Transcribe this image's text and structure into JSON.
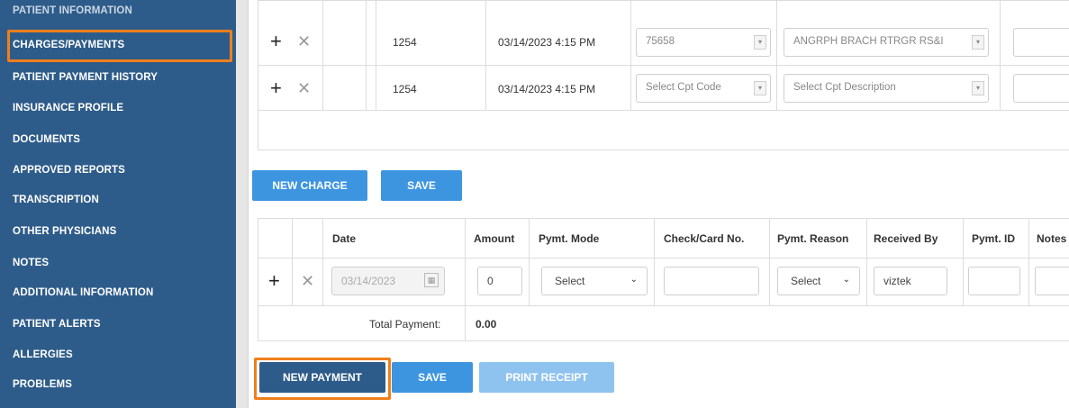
{
  "sidebar": {
    "items": [
      {
        "label": "PATIENT INFORMATION"
      },
      {
        "label": "CHARGES/PAYMENTS"
      },
      {
        "label": "PATIENT PAYMENT HISTORY"
      },
      {
        "label": "INSURANCE PROFILE"
      },
      {
        "label": "DOCUMENTS"
      },
      {
        "label": "APPROVED REPORTS"
      },
      {
        "label": "TRANSCRIPTION"
      },
      {
        "label": "OTHER PHYSICIANS"
      },
      {
        "label": "NOTES"
      },
      {
        "label": "ADDITIONAL INFORMATION"
      },
      {
        "label": "PATIENT ALERTS"
      },
      {
        "label": "ALLERGIES"
      },
      {
        "label": "PROBLEMS"
      }
    ],
    "active_index": 1
  },
  "charges": {
    "rows": [
      {
        "id": "1254",
        "datetime": "03/14/2023 4:15 PM",
        "cpt_code": "75658",
        "cpt_description": "ANGRPH BRACH RTRGR RS&I"
      },
      {
        "id": "1254",
        "datetime": "03/14/2023 4:15 PM",
        "cpt_code": "Select Cpt Code",
        "cpt_description": "Select Cpt Description"
      }
    ],
    "buttons": {
      "new_charge": "NEW CHARGE",
      "save": "SAVE"
    }
  },
  "payments": {
    "headers": {
      "date": "Date",
      "amount": "Amount",
      "pymt_mode": "Pymt. Mode",
      "check_card": "Check/Card No.",
      "pymt_reason": "Pymt. Reason",
      "received_by": "Received By",
      "pymt_id": "Pymt. ID",
      "notes": "Notes"
    },
    "row": {
      "date": "03/14/2023",
      "amount": "0",
      "pymt_mode": "Select",
      "check_card": "",
      "pymt_reason": "Select",
      "received_by": "viztek",
      "pymt_id": "",
      "notes": ""
    },
    "total_label": "Total Payment:",
    "total_value": "0.00",
    "buttons": {
      "new_payment": "NEW PAYMENT",
      "save": "SAVE",
      "print_receipt": "PRINT RECEIPT"
    }
  },
  "colors": {
    "sidebar_bg": "#2e5c8a",
    "button_blue": "#3d95e0",
    "highlight_orange": "#f07f1b"
  }
}
